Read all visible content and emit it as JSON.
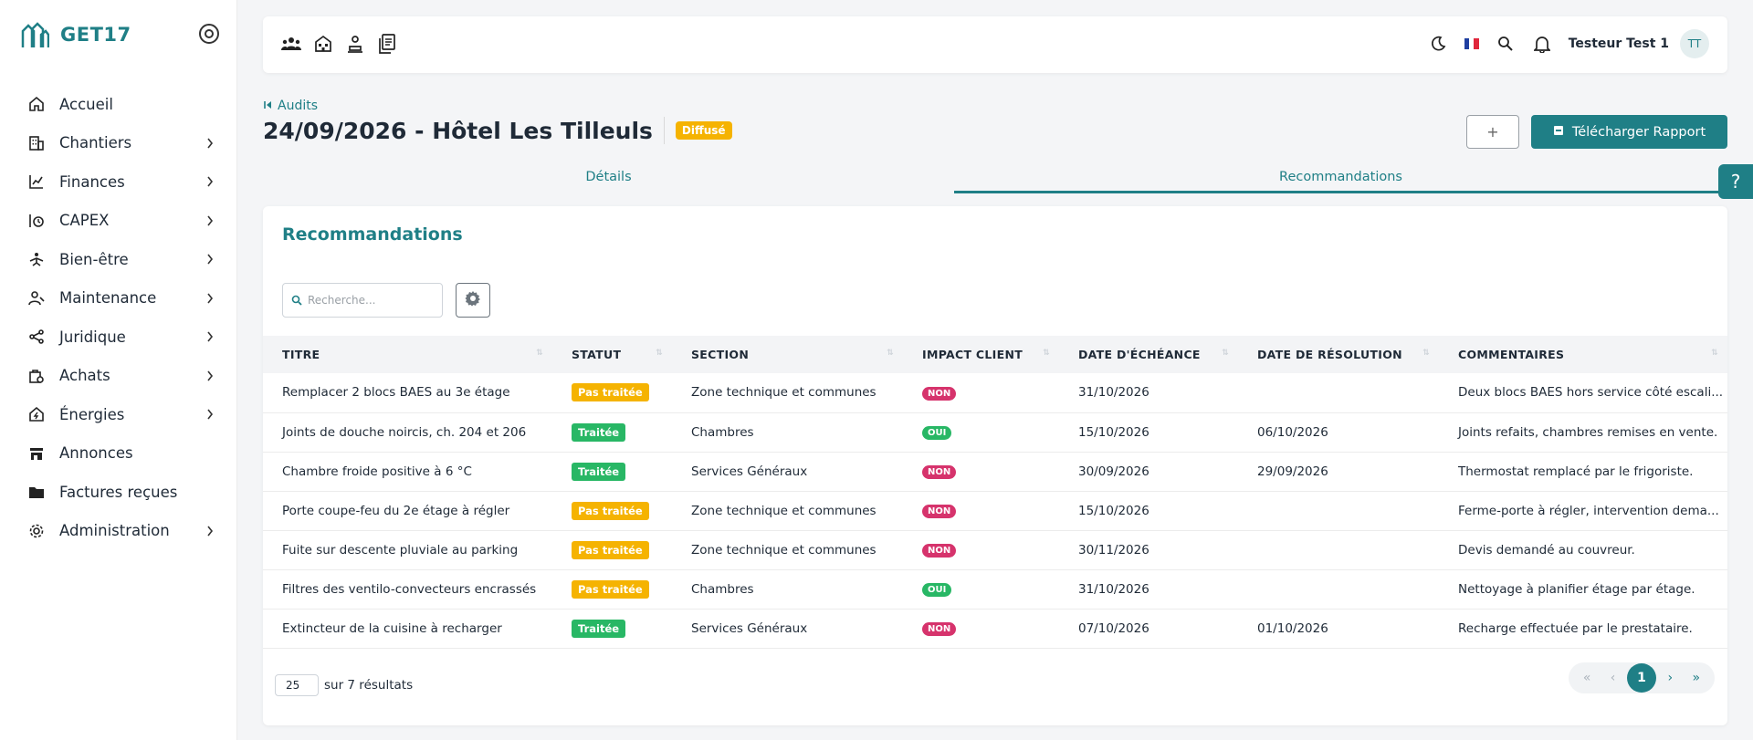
{
  "brand": {
    "name": "GET17"
  },
  "sidebar": {
    "items": [
      {
        "label": "Accueil",
        "icon": "home-icon",
        "has_submenu": false
      },
      {
        "label": "Chantiers",
        "icon": "building-icon",
        "has_submenu": true
      },
      {
        "label": "Finances",
        "icon": "finance-icon",
        "has_submenu": true
      },
      {
        "label": "CAPEX",
        "icon": "capex-icon",
        "has_submenu": true
      },
      {
        "label": "Bien-être",
        "icon": "wellbeing-icon",
        "has_submenu": true
      },
      {
        "label": "Maintenance",
        "icon": "maintenance-icon",
        "has_submenu": true
      },
      {
        "label": "Juridique",
        "icon": "share-icon",
        "has_submenu": true
      },
      {
        "label": "Achats",
        "icon": "purchase-icon",
        "has_submenu": true
      },
      {
        "label": "Énergies",
        "icon": "energy-icon",
        "has_submenu": true
      },
      {
        "label": "Annonces",
        "icon": "store-icon",
        "has_submenu": false
      },
      {
        "label": "Factures reçues",
        "icon": "folder-icon",
        "has_submenu": false
      },
      {
        "label": "Administration",
        "icon": "gear-icon",
        "has_submenu": true
      }
    ]
  },
  "topbar": {
    "user_name": "Testeur Test 1",
    "avatar_initials": "TT",
    "left_icons": [
      "users-icon",
      "hotel-icon",
      "person-icon",
      "document-icon"
    ],
    "right_icons": [
      "moon-icon",
      "flag-fr-icon",
      "search-icon",
      "bell-icon"
    ]
  },
  "header": {
    "breadcrumb": "Audits",
    "title": "24/09/2026 - Hôtel Les Tilleuls",
    "status_badge": "Diffusé",
    "add_button": "+",
    "download_button": "Télécharger Rapport",
    "help_button": "?"
  },
  "tabs": [
    {
      "label": "Détails",
      "active": false
    },
    {
      "label": "Recommandations",
      "active": true
    }
  ],
  "panel": {
    "title": "Recommandations",
    "search_placeholder": "Recherche..."
  },
  "table": {
    "columns": [
      "TITRE",
      "STATUT",
      "SECTION",
      "IMPACT CLIENT",
      "DATE D'ÉCHÉANCE",
      "DATE DE RÉSOLUTION",
      "COMMENTAIRES"
    ],
    "rows": [
      {
        "titre": "Remplacer 2 blocs BAES au 3e étage",
        "statut": "Pas traitée",
        "section": "Zone technique et communes",
        "impact": "NON",
        "echeance": "31/10/2026",
        "resolution": "",
        "commentaire": "Deux blocs BAES hors service côté escali..."
      },
      {
        "titre": "Joints de douche noircis, ch. 204 et 206",
        "statut": "Traitée",
        "section": "Chambres",
        "impact": "OUI",
        "echeance": "15/10/2026",
        "resolution": "06/10/2026",
        "commentaire": "Joints refaits, chambres remises en vente."
      },
      {
        "titre": "Chambre froide positive à 6 °C",
        "statut": "Traitée",
        "section": "Services Généraux",
        "impact": "NON",
        "echeance": "30/09/2026",
        "resolution": "29/09/2026",
        "commentaire": "Thermostat remplacé par le frigoriste."
      },
      {
        "titre": "Porte coupe-feu du 2e étage à régler",
        "statut": "Pas traitée",
        "section": "Zone technique et communes",
        "impact": "NON",
        "echeance": "15/10/2026",
        "resolution": "",
        "commentaire": "Ferme-porte à régler, intervention dema..."
      },
      {
        "titre": "Fuite sur descente pluviale au parking",
        "statut": "Pas traitée",
        "section": "Zone technique et communes",
        "impact": "NON",
        "echeance": "30/11/2026",
        "resolution": "",
        "commentaire": "Devis demandé au couvreur."
      },
      {
        "titre": "Filtres des ventilo-convecteurs encrassés",
        "statut": "Pas traitée",
        "section": "Chambres",
        "impact": "OUI",
        "echeance": "31/10/2026",
        "resolution": "",
        "commentaire": "Nettoyage à planifier étage par étage."
      },
      {
        "titre": "Extincteur de la cuisine à recharger",
        "statut": "Traitée",
        "section": "Services Généraux",
        "impact": "NON",
        "echeance": "07/10/2026",
        "resolution": "01/10/2026",
        "commentaire": "Recharge effectuée par le prestataire."
      }
    ]
  },
  "footer": {
    "page_size": "25",
    "results_text": "sur 7 résultats",
    "pager": {
      "first": "«",
      "prev": "‹",
      "current": "1",
      "next": "›",
      "last": "»"
    }
  },
  "colors": {
    "accent": "#1f7f86",
    "pas_traitee": "#f5b301",
    "traitee": "#28b765",
    "impact_non": "#d6336c",
    "impact_oui": "#28b765"
  }
}
